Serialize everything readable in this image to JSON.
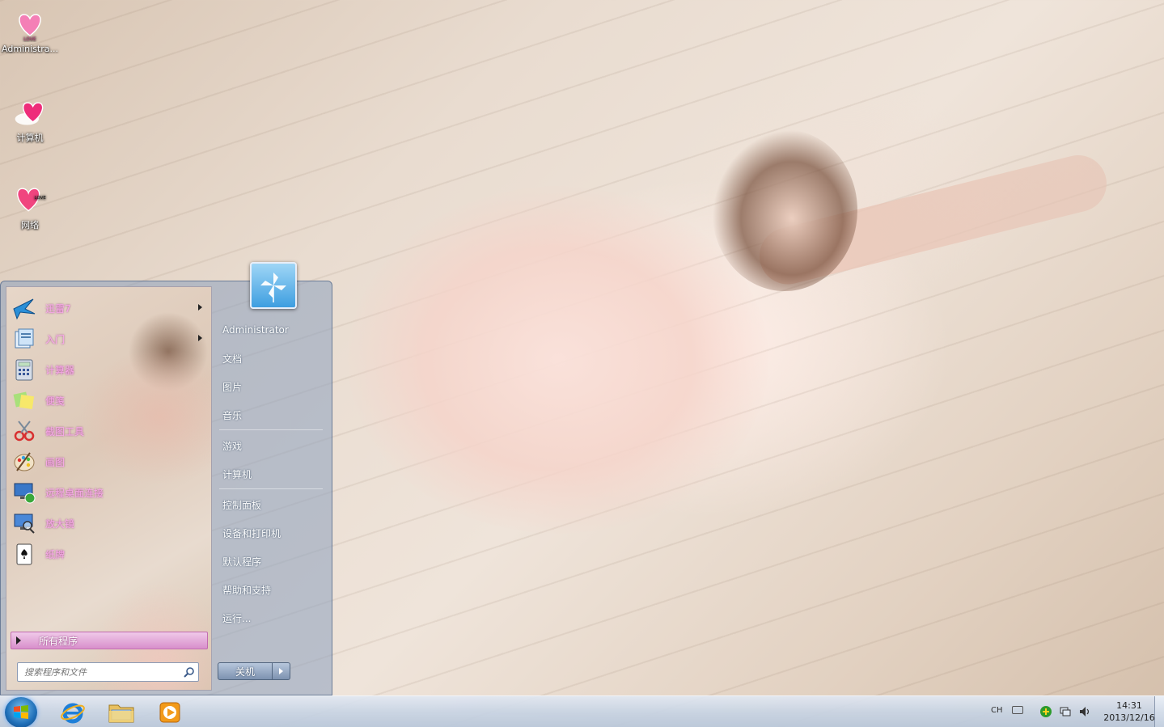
{
  "desktop": {
    "icons": [
      {
        "label": "Administra...",
        "icon": "love-heart-icon"
      },
      {
        "label": "计算机",
        "icon": "computer-heart-icon"
      },
      {
        "label": "网络",
        "icon": "network-heart-icon"
      }
    ]
  },
  "start_menu": {
    "programs": [
      {
        "label": "迅雷7",
        "icon": "thunder-bird-icon",
        "has_submenu": true
      },
      {
        "label": "入门",
        "icon": "getting-started-icon",
        "has_submenu": true
      },
      {
        "label": "计算器",
        "icon": "calculator-icon",
        "has_submenu": false
      },
      {
        "label": "便笺",
        "icon": "sticky-notes-icon",
        "has_submenu": false
      },
      {
        "label": "截图工具",
        "icon": "snipping-tool-icon",
        "has_submenu": false
      },
      {
        "label": "画图",
        "icon": "paint-palette-icon",
        "has_submenu": false
      },
      {
        "label": "远程桌面连接",
        "icon": "remote-desktop-icon",
        "has_submenu": false
      },
      {
        "label": "放大镜",
        "icon": "magnifier-icon",
        "has_submenu": false
      },
      {
        "label": "纸牌",
        "icon": "solitaire-cards-icon",
        "has_submenu": false
      }
    ],
    "all_programs_label": "所有程序",
    "search_placeholder": "搜索程序和文件",
    "right_items": {
      "user": "Administrator",
      "documents": "文档",
      "pictures": "图片",
      "music": "音乐",
      "games": "游戏",
      "computer": "计算机",
      "control_panel": "控制面板",
      "devices_printers": "设备和打印机",
      "default_programs": "默认程序",
      "help_support": "帮助和支持",
      "run": "运行..."
    },
    "shutdown_label": "关机"
  },
  "taskbar": {
    "pinned": [
      {
        "name": "internet-explorer",
        "icon": "ie-icon"
      },
      {
        "name": "windows-explorer",
        "icon": "folder-icon"
      },
      {
        "name": "media-player",
        "icon": "media-player-icon"
      }
    ],
    "tray": {
      "language": "CH",
      "time": "14:31",
      "date": "2013/12/16"
    }
  },
  "colors": {
    "program_label": "#f7a8e6",
    "all_programs_bg": "#e0a3d6",
    "taskbar": "#c8d4e4"
  }
}
